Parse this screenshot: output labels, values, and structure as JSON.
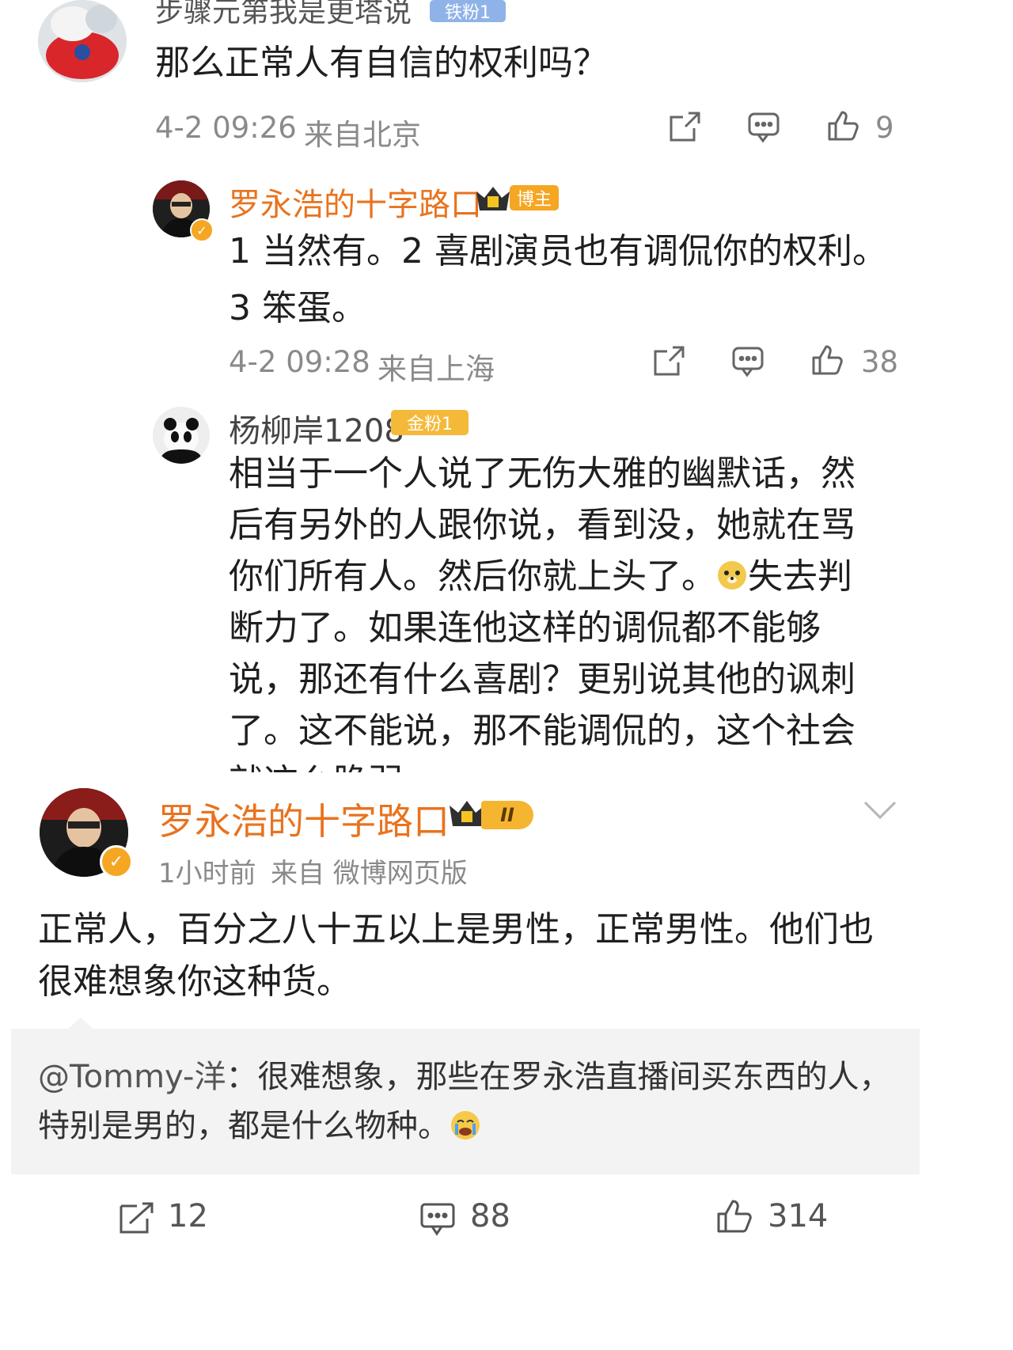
{
  "comment1": {
    "username_partial": "步骤元第我是更塔说",
    "fan_badge": "铁粉1",
    "text": "那么正常人有自信的权利吗？",
    "time": "4-2 09:26",
    "location": "来自北京",
    "likes": "9"
  },
  "reply1": {
    "username": "罗永浩的十字路口",
    "role_badge": "博主",
    "text": "1 当然有。2 喜剧演员也有调侃你的权利。3 笨蛋。",
    "time": "4-2 09:28",
    "location": "来自上海",
    "likes": "38"
  },
  "reply2": {
    "username": "杨柳岸1208",
    "fan_badge": "金粉1",
    "text_before_emoji": "相当于一个人说了无伤大雅的幽默话，然后有另外的人跟你说，看到没，她就在骂你们所有人。然后你就上头了。",
    "emoji_name": "doge-emoji",
    "text_after_emoji": "失去判断力了。如果连他这样的调侃都不能够说，那还有什么喜剧？更别说其他的讽刺了。这不能说，那不能调侃的，这个社会就这么脆弱"
  },
  "post": {
    "username": "罗永浩的十字路口",
    "level_badge": "II",
    "time": "1小时前",
    "source": "来自 微博网页版",
    "text": "正常人，百分之八十五以上是男性，正常男性。他们也很难想象你这种货。",
    "quote": {
      "mention": "@Tommy-洋",
      "text": "：很难想象，那些在罗永浩直播间买东西的人，特别是男的，都是什么物种。",
      "emoji_name": "crying-emoji"
    },
    "shares": "12",
    "comments": "88",
    "likes": "314"
  },
  "colors": {
    "name": "#e8731f",
    "meta": "#8a8a8a",
    "badge_orange": "#f5a623",
    "quote_bg": "#f3f3f3"
  }
}
